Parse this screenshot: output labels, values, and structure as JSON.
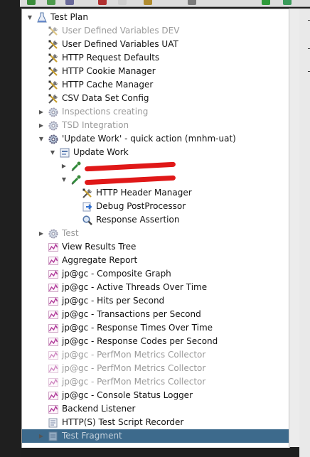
{
  "tree": {
    "nodes": [
      {
        "label": "Test Plan",
        "icon": "test-plan-icon",
        "indent": 0,
        "toggle": "expanded",
        "disabled": false,
        "selected": false
      },
      {
        "label": "User Defined Variables DEV",
        "icon": "config-element-wrench-icon",
        "indent": 1,
        "toggle": "none",
        "disabled": true,
        "selected": false
      },
      {
        "label": "User Defined Variables UAT",
        "icon": "config-element-wrench-icon",
        "indent": 1,
        "toggle": "none",
        "disabled": false,
        "selected": false
      },
      {
        "label": "HTTP Request Defaults",
        "icon": "config-element-wrench-icon",
        "indent": 1,
        "toggle": "none",
        "disabled": false,
        "selected": false
      },
      {
        "label": "HTTP Cookie Manager",
        "icon": "config-element-wrench-icon",
        "indent": 1,
        "toggle": "none",
        "disabled": false,
        "selected": false
      },
      {
        "label": "HTTP Cache Manager",
        "icon": "config-element-wrench-icon",
        "indent": 1,
        "toggle": "none",
        "disabled": false,
        "selected": false
      },
      {
        "label": "CSV Data Set Config",
        "icon": "config-element-wrench-icon",
        "indent": 1,
        "toggle": "none",
        "disabled": false,
        "selected": false
      },
      {
        "label": "Inspections creating",
        "icon": "thread-group-gear-icon",
        "indent": 1,
        "toggle": "collapsed",
        "disabled": true,
        "selected": false
      },
      {
        "label": "TSD Integration",
        "icon": "thread-group-gear-icon",
        "indent": 1,
        "toggle": "collapsed",
        "disabled": true,
        "selected": false
      },
      {
        "label": "'Update Work' - quick action (mnhm-uat)",
        "icon": "thread-group-gear-icon",
        "indent": 1,
        "toggle": "expanded",
        "disabled": false,
        "selected": false
      },
      {
        "label": "Update Work",
        "icon": "transaction-controller-icon",
        "indent": 2,
        "toggle": "expanded",
        "disabled": false,
        "selected": false
      },
      {
        "label": "",
        "icon": "http-sampler-pipette-icon",
        "indent": 3,
        "toggle": "collapsed",
        "disabled": false,
        "selected": false,
        "redacted": true
      },
      {
        "label": "",
        "icon": "http-sampler-pipette-icon",
        "indent": 3,
        "toggle": "expanded",
        "disabled": false,
        "selected": false,
        "redacted": true
      },
      {
        "label": "HTTP Header Manager",
        "icon": "config-element-wrench-icon",
        "indent": 4,
        "toggle": "none",
        "disabled": false,
        "selected": false
      },
      {
        "label": "Debug PostProcessor",
        "icon": "post-processor-arrow-icon",
        "indent": 4,
        "toggle": "none",
        "disabled": false,
        "selected": false
      },
      {
        "label": "Response Assertion",
        "icon": "assertion-magnifier-icon",
        "indent": 4,
        "toggle": "none",
        "disabled": false,
        "selected": false
      },
      {
        "label": "Test",
        "icon": "thread-group-gear-icon",
        "indent": 1,
        "toggle": "collapsed",
        "disabled": true,
        "selected": false
      },
      {
        "label": "View Results Tree",
        "icon": "listener-graph-icon",
        "indent": 1,
        "toggle": "none",
        "disabled": false,
        "selected": false
      },
      {
        "label": "Aggregate Report",
        "icon": "listener-graph-icon",
        "indent": 1,
        "toggle": "none",
        "disabled": false,
        "selected": false
      },
      {
        "label": "jp@gc - Composite Graph",
        "icon": "listener-graph-icon",
        "indent": 1,
        "toggle": "none",
        "disabled": false,
        "selected": false
      },
      {
        "label": "jp@gc - Active Threads Over Time",
        "icon": "listener-graph-icon",
        "indent": 1,
        "toggle": "none",
        "disabled": false,
        "selected": false
      },
      {
        "label": "jp@gc - Hits per Second",
        "icon": "listener-graph-icon",
        "indent": 1,
        "toggle": "none",
        "disabled": false,
        "selected": false
      },
      {
        "label": "jp@gc - Transactions per Second",
        "icon": "listener-graph-icon",
        "indent": 1,
        "toggle": "none",
        "disabled": false,
        "selected": false
      },
      {
        "label": "jp@gc - Response Times Over Time",
        "icon": "listener-graph-icon",
        "indent": 1,
        "toggle": "none",
        "disabled": false,
        "selected": false
      },
      {
        "label": "jp@gc - Response Codes per Second",
        "icon": "listener-graph-icon",
        "indent": 1,
        "toggle": "none",
        "disabled": false,
        "selected": false
      },
      {
        "label": "jp@gc - PerfMon Metrics Collector",
        "icon": "listener-graph-icon",
        "indent": 1,
        "toggle": "none",
        "disabled": true,
        "selected": false
      },
      {
        "label": "jp@gc - PerfMon Metrics Collector",
        "icon": "listener-graph-icon",
        "indent": 1,
        "toggle": "none",
        "disabled": true,
        "selected": false
      },
      {
        "label": "jp@gc - PerfMon Metrics Collector",
        "icon": "listener-graph-icon",
        "indent": 1,
        "toggle": "none",
        "disabled": true,
        "selected": false
      },
      {
        "label": "jp@gc - Console Status Logger",
        "icon": "listener-graph-icon",
        "indent": 1,
        "toggle": "none",
        "disabled": false,
        "selected": false
      },
      {
        "label": "Backend Listener",
        "icon": "listener-graph-icon",
        "indent": 1,
        "toggle": "none",
        "disabled": false,
        "selected": false
      },
      {
        "label": "HTTP(S) Test Script Recorder",
        "icon": "recorder-icon",
        "indent": 1,
        "toggle": "none",
        "disabled": false,
        "selected": false
      },
      {
        "label": "Test Fragment",
        "icon": "test-fragment-icon",
        "indent": 1,
        "toggle": "collapsed",
        "disabled": true,
        "selected": true
      }
    ]
  },
  "colors": {
    "selection": "#3d6a8c",
    "disabled_text": "#9a9a9a",
    "redaction": "#e01818"
  }
}
